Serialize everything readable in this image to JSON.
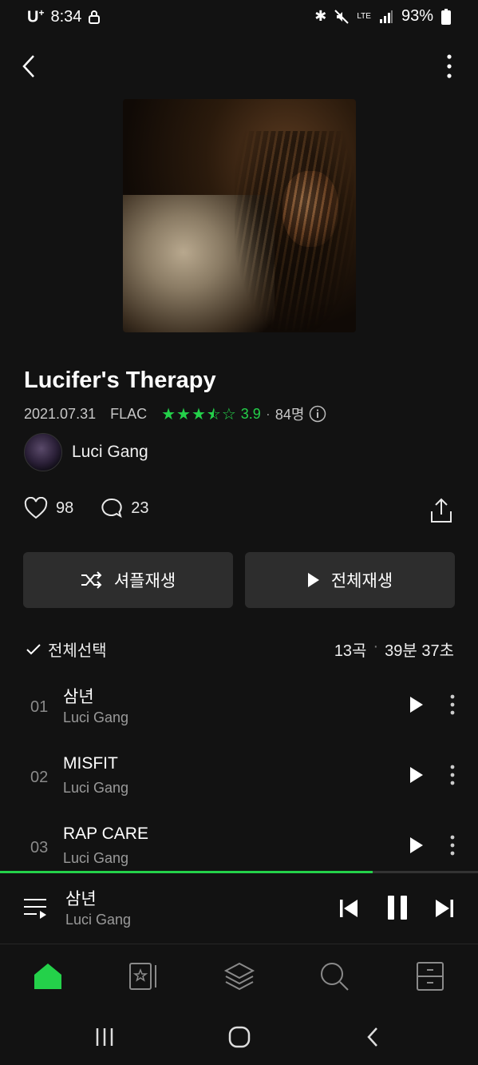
{
  "status": {
    "carrier": "U",
    "carrier_sup": "+",
    "time": "8:34",
    "network": "LTE",
    "battery": "93%"
  },
  "album": {
    "title": "Lucifer's Therapy",
    "date": "2021.07.31",
    "format": "FLAC",
    "rating": "3.9",
    "rating_stars": 3.5,
    "rating_count": "84명",
    "artist": "Luci Gang"
  },
  "social": {
    "likes": "98",
    "comments": "23"
  },
  "buttons": {
    "shuffle": "셔플재생",
    "play_all": "전체재생"
  },
  "list": {
    "select_all": "전체선택",
    "count": "13곡",
    "duration": "39분 37초"
  },
  "tracks": [
    {
      "num": "01",
      "name": "삼년",
      "artist": "Luci Gang"
    },
    {
      "num": "02",
      "name": "MISFIT",
      "artist": "Luci Gang"
    },
    {
      "num": "03",
      "name": "RAP CARE",
      "artist": "Luci Gang"
    }
  ],
  "now_playing": {
    "name": "삼년",
    "artist": "Luci Gang",
    "progress": 0.78
  },
  "colors": {
    "accent": "#24d14a",
    "background": "#121212",
    "button": "#2d2d2d"
  },
  "tabs": [
    "home-icon",
    "library-icon",
    "layers-icon",
    "search-icon",
    "storage-icon"
  ]
}
